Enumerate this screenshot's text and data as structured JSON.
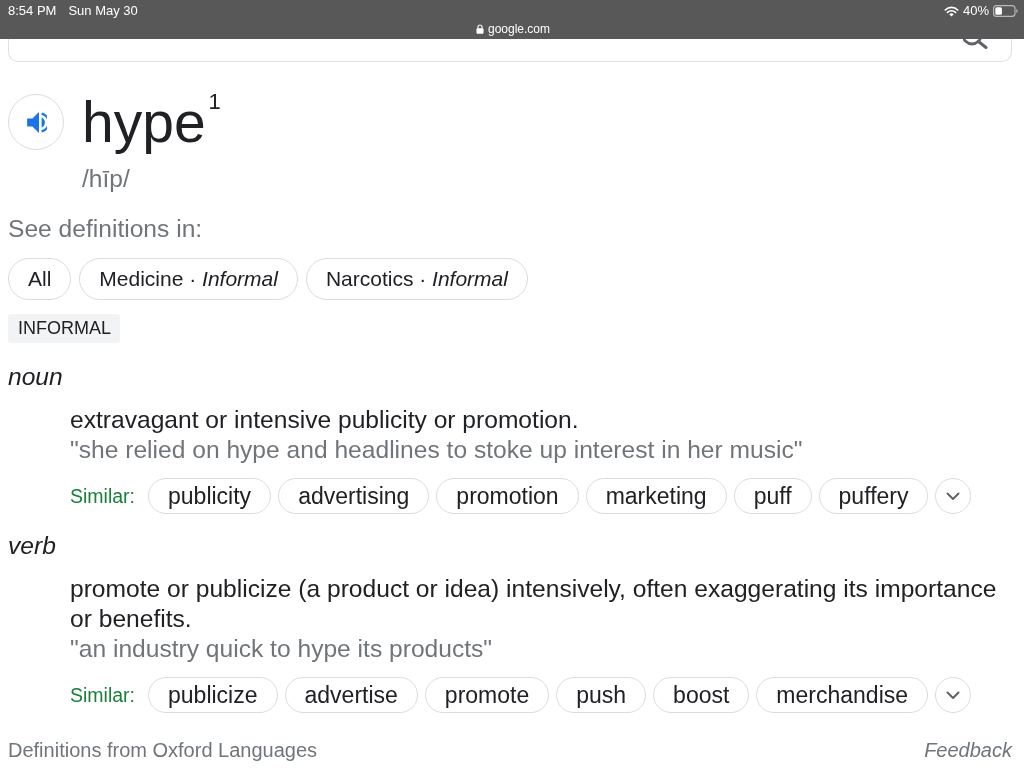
{
  "status_bar": {
    "time": "8:54 PM",
    "date": "Sun May 30",
    "url": "google.com",
    "battery": "40%"
  },
  "entry": {
    "word": "hype$^{1}$",
    "pronunciation": "/hīp/"
  },
  "see_definitions": {
    "label": "See definitions in:",
    "chips": [
      "All",
      "Medicine · *Informal*",
      "Narcotics · *Informal*"
    ]
  },
  "register": "INFORMAL",
  "senses": [
    {
      "part_of_speech": "noun",
      "definition": "extravagant or intensive publicity or promotion.",
      "example": "\"she relied on hype and headlines to stoke up interest in her music\"",
      "similar_label": "Similar:",
      "similar": [
        "publicity",
        "advertising",
        "promotion",
        "marketing",
        "puff",
        "puffery"
      ]
    },
    {
      "part_of_speech": "verb",
      "definition": "promote or publicize (a product or idea) intensively, often exaggerating its importance or benefits.",
      "example": "\"an industry quick to hype its products\"",
      "similar_label": "Similar:",
      "similar": [
        "publicize",
        "advertise",
        "promote",
        "push",
        "boost",
        "merchandise"
      ]
    }
  ],
  "footer": {
    "source": "Definitions from Oxford Languages",
    "feedback": "Feedback"
  }
}
